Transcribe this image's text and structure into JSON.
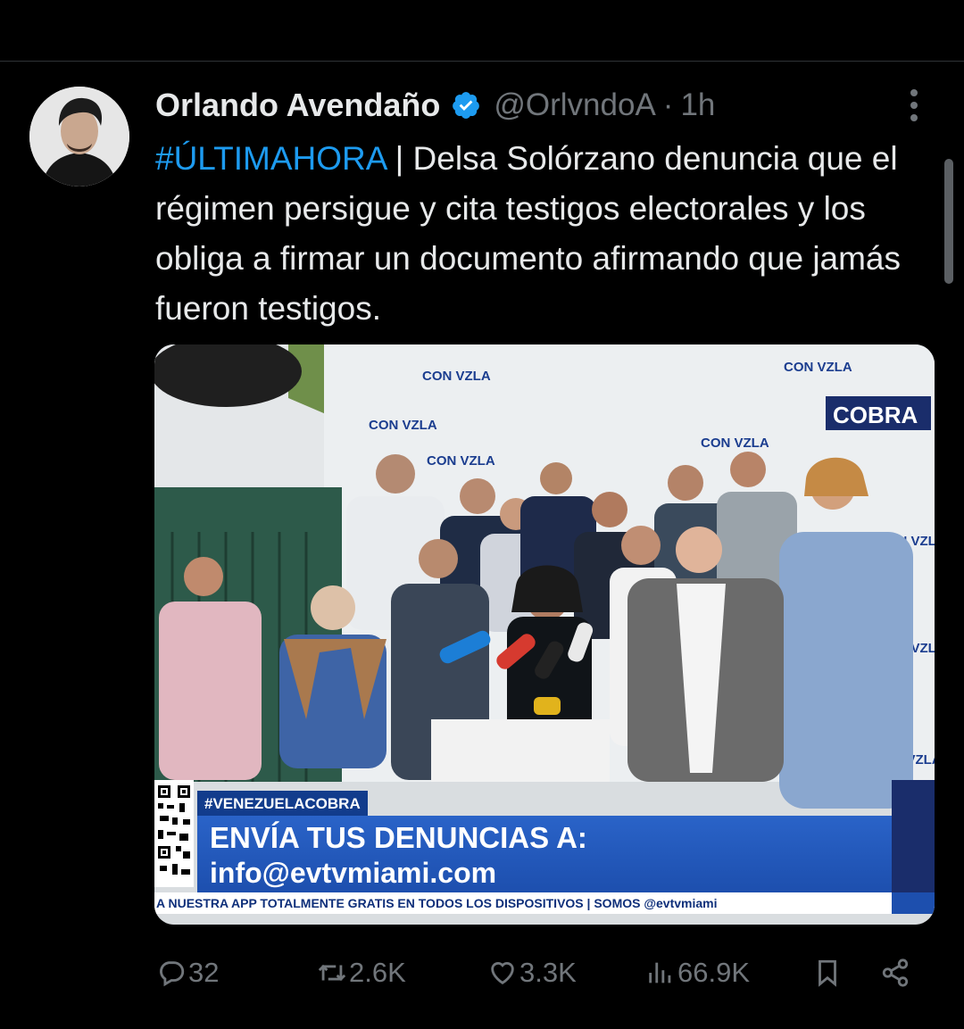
{
  "tweet": {
    "author": {
      "display_name": "Orlando Avendaño",
      "handle": "@OrlvndoA",
      "verified": true,
      "avatar_icon": "avatar-photo"
    },
    "separator": "·",
    "time": "1h",
    "hashtag": "#ÚLTIMAHORA",
    "text": " | Delsa Solórzano denuncia que el régimen persigue y cita testigos electorales y los obliga a firmar un documento afirmando que jamás fueron testigos."
  },
  "media": {
    "overlay": {
      "tag": "#VENEZUELACOBRA",
      "line1": "ENVÍA TUS DENUNCIAS A:",
      "line2": "info@evtvmiami.com",
      "ticker": "A NUESTRA APP TOTALMENTE GRATIS EN TODOS LOS DISPOSITIVOS | SOMOS @evtvmiami"
    },
    "backdrop_logo": "CON VZLA",
    "corner_logo": "COBRA"
  },
  "actions": {
    "replies": "32",
    "retweets": "2.6K",
    "likes": "3.3K",
    "views": "66.9K"
  },
  "colors": {
    "background": "#000000",
    "text": "#e7e9ea",
    "secondary": "#71767b",
    "accent": "#1d9bf0",
    "divider": "#2f3336"
  }
}
